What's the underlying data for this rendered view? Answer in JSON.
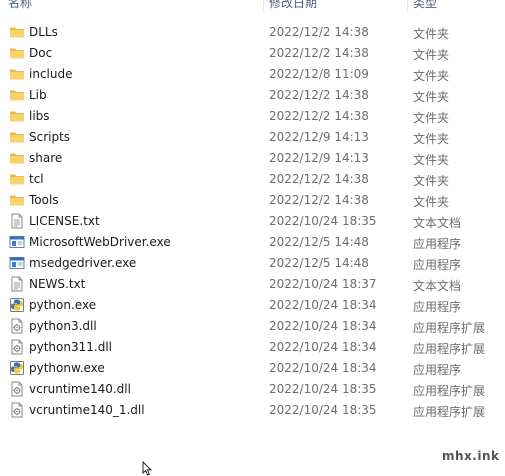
{
  "columns": {
    "name": "名称",
    "modified": "修改日期",
    "type": "类型"
  },
  "files": [
    {
      "name": "DLLs",
      "modified": "2022/12/2 14:38",
      "type": "文件夹",
      "icon": "folder-icon"
    },
    {
      "name": "Doc",
      "modified": "2022/12/2 14:38",
      "type": "文件夹",
      "icon": "folder-icon"
    },
    {
      "name": "include",
      "modified": "2022/12/8 11:09",
      "type": "文件夹",
      "icon": "folder-icon"
    },
    {
      "name": "Lib",
      "modified": "2022/12/2 14:38",
      "type": "文件夹",
      "icon": "folder-icon"
    },
    {
      "name": "libs",
      "modified": "2022/12/2 14:38",
      "type": "文件夹",
      "icon": "folder-icon"
    },
    {
      "name": "Scripts",
      "modified": "2022/12/9 14:13",
      "type": "文件夹",
      "icon": "folder-icon"
    },
    {
      "name": "share",
      "modified": "2022/12/9 14:13",
      "type": "文件夹",
      "icon": "folder-icon"
    },
    {
      "name": "tcl",
      "modified": "2022/12/2 14:38",
      "type": "文件夹",
      "icon": "folder-icon"
    },
    {
      "name": "Tools",
      "modified": "2022/12/2 14:38",
      "type": "文件夹",
      "icon": "folder-icon"
    },
    {
      "name": "LICENSE.txt",
      "modified": "2022/10/24 18:35",
      "type": "文本文档",
      "icon": "text-file-icon"
    },
    {
      "name": "MicrosoftWebDriver.exe",
      "modified": "2022/12/5 14:48",
      "type": "应用程序",
      "icon": "app-window-icon"
    },
    {
      "name": "msedgedriver.exe",
      "modified": "2022/12/5 14:48",
      "type": "应用程序",
      "icon": "app-window-icon"
    },
    {
      "name": "NEWS.txt",
      "modified": "2022/10/24 18:37",
      "type": "文本文档",
      "icon": "text-file-icon"
    },
    {
      "name": "python.exe",
      "modified": "2022/10/24 18:34",
      "type": "应用程序",
      "icon": "python-icon"
    },
    {
      "name": "python3.dll",
      "modified": "2022/10/24 18:34",
      "type": "应用程序扩展",
      "icon": "dll-file-icon"
    },
    {
      "name": "python311.dll",
      "modified": "2022/10/24 18:34",
      "type": "应用程序扩展",
      "icon": "dll-file-icon"
    },
    {
      "name": "pythonw.exe",
      "modified": "2022/10/24 18:34",
      "type": "应用程序",
      "icon": "python-icon"
    },
    {
      "name": "vcruntime140.dll",
      "modified": "2022/10/24 18:35",
      "type": "应用程序扩展",
      "icon": "dll-file-icon"
    },
    {
      "name": "vcruntime140_1.dll",
      "modified": "2022/10/24 18:35",
      "type": "应用程序扩展",
      "icon": "dll-file-icon"
    }
  ],
  "watermark": "mhx.ink"
}
